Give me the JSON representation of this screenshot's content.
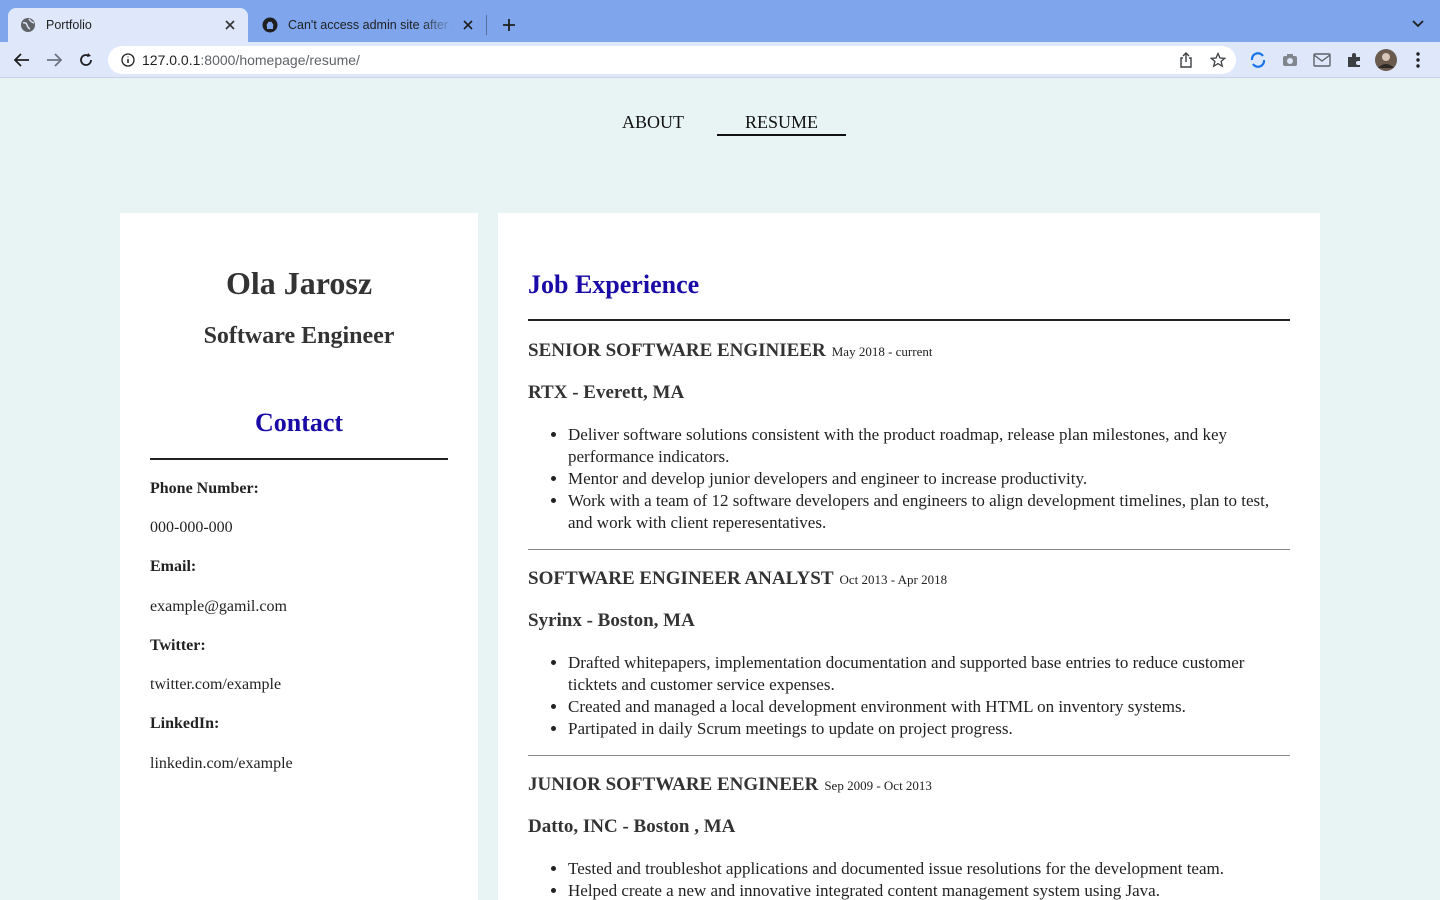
{
  "browser": {
    "tabs": [
      {
        "title": "Portfolio",
        "active": true
      },
      {
        "title": "Can't access admin site after d",
        "active": false
      }
    ],
    "url_host": "127.0.0.1",
    "url_rest": ":8000/homepage/resume/"
  },
  "nav": {
    "about": "ABOUT",
    "resume": "RESUME",
    "active": "resume"
  },
  "profile": {
    "name": "Ola Jarosz",
    "role": "Software Engineer"
  },
  "contact": {
    "heading": "Contact",
    "phone_label": "Phone Number:",
    "phone": "000-000-000",
    "email_label": "Email:",
    "email": "example@gamil.com",
    "twitter_label": "Twitter:",
    "twitter": "twitter.com/example",
    "linkedin_label": "LinkedIn:",
    "linkedin": "linkedin.com/example"
  },
  "experience": {
    "heading": "Job Experience",
    "jobs": [
      {
        "title": "SENIOR SOFTWARE ENGINIEER",
        "dates": "May 2018 - current",
        "company": "RTX - Everett, MA",
        "bullets": [
          "Deliver software solutions consistent with the product roadmap, release plan milestones, and key performance indicators.",
          "Mentor and develop junior developers and engineer to increase productivity.",
          "Work with a team of 12 software developers and engineers to align development timelines, plan to test, and work with client reperesentatives."
        ]
      },
      {
        "title": "SOFTWARE ENGINEER ANALYST",
        "dates": "Oct 2013 - Apr 2018",
        "company": "Syrinx - Boston, MA",
        "bullets": [
          "Drafted whitepapers, implementation documentation and supported base entries to reduce customer ticktets and customer service expenses.",
          "Created and managed a local development environment  with HTML on inventory systems.",
          "Partipated in daily Scrum meetings to update on project progress."
        ]
      },
      {
        "title": "JUNIOR SOFTWARE ENGINEER",
        "dates": "Sep 2009 - Oct 2013",
        "company": "Datto, INC - Boston , MA",
        "bullets": [
          "Tested and troubleshot applications and documented issue resolutions for the development team.",
          "Helped create a new and innovative integrated content management system using Java."
        ]
      }
    ]
  },
  "colors": {
    "page_bg": "#e8f4f3",
    "heading_blue": "#1a0aa6",
    "tabstrip": "#7fa6ec",
    "toolbar": "#dfe8fb"
  }
}
